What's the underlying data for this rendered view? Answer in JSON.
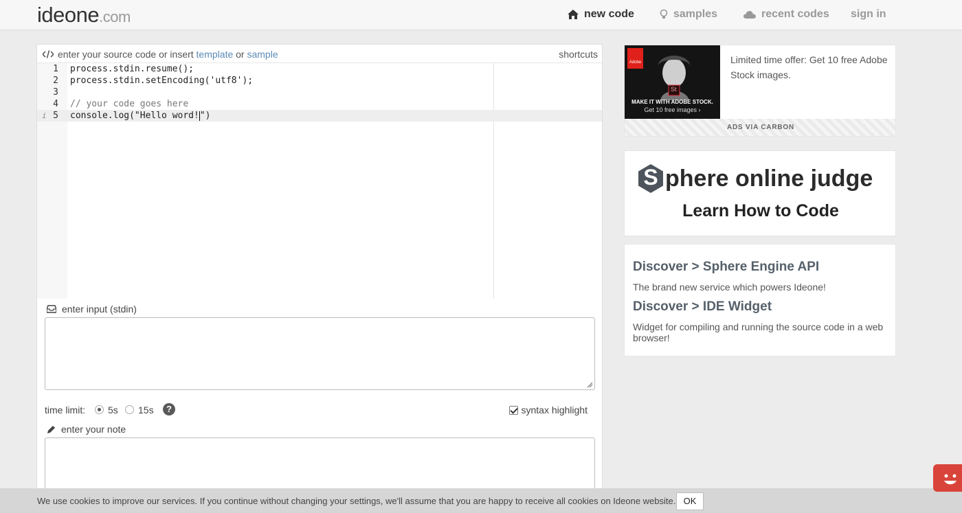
{
  "header": {
    "logo_main": "ideone",
    "logo_suffix": ".com",
    "nav": [
      {
        "label": "new code",
        "icon": "home-icon"
      },
      {
        "label": "samples",
        "icon": "lightbulb-icon"
      },
      {
        "label": "recent codes",
        "icon": "cloud-icon"
      },
      {
        "label": "sign in"
      }
    ]
  },
  "editor": {
    "prompt_pre": "enter your source code or insert",
    "template_link": "template",
    "or": "or",
    "sample_link": "sample",
    "shortcuts": "shortcuts",
    "lines": [
      {
        "num": "1",
        "text": "process.stdin.resume();"
      },
      {
        "num": "2",
        "text": "process.stdin.setEncoding('utf8');"
      },
      {
        "num": "3",
        "text": ""
      },
      {
        "num": "4",
        "text": "// your code goes here"
      },
      {
        "num": "5",
        "text_before_cursor": "console.log(\"Hello word!",
        "text_after_cursor": "\")"
      }
    ],
    "info_marker": "i"
  },
  "input": {
    "label": "enter input (stdin)",
    "value": ""
  },
  "options": {
    "time_limit_label": "time limit:",
    "opt_5s": "5s",
    "opt_15s": "15s",
    "selected": "5s",
    "help": "?",
    "syntax_label": "syntax highlight",
    "syntax_checked": true
  },
  "note": {
    "label": "enter your note",
    "value": ""
  },
  "ad": {
    "brand": "Adobe",
    "badge": "St",
    "headline": "MAKE IT WITH ADOBE STOCK.",
    "cta": "Get 10 free images ›",
    "text": "Limited time offer: Get 10 free Adobe Stock images.",
    "footer": "ADS VIA CARBON"
  },
  "spoj": {
    "title_rest": "phere online judge",
    "title_letter": "S",
    "subtitle": "Learn How to Code"
  },
  "discover": [
    {
      "title": "Discover > Sphere Engine API",
      "text": "The brand new service which powers Ideone!"
    },
    {
      "title": "Discover > IDE Widget",
      "text": "Widget for compiling and running the source code in a web browser!"
    }
  ],
  "cookie": {
    "text": "We use cookies to improve our services. If you continue without changing your settings, we'll assume that you are happy to receive all cookies on Ideone website.",
    "ok": "OK"
  },
  "colors": {
    "link": "#5b8bb5",
    "chat_widget": "#d9443a",
    "adobe_red": "#e0211b"
  }
}
